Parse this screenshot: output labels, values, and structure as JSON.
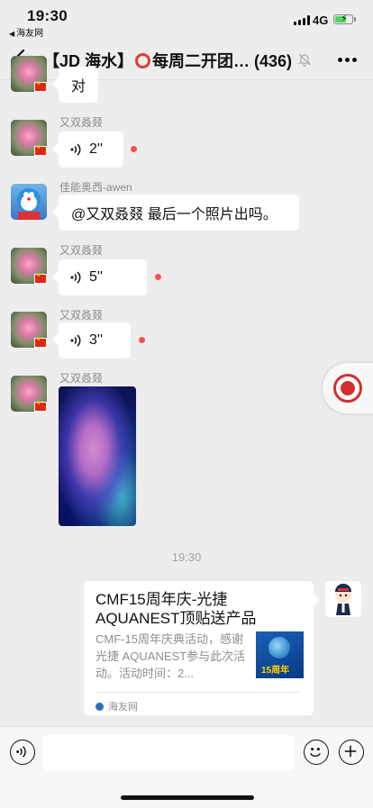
{
  "status_bar": {
    "time": "19:30",
    "back_app": "海友网",
    "network": "4G"
  },
  "nav": {
    "title_prefix": "【JD 海水】",
    "title_suffix": "每周二开团…",
    "member_count": "(436)"
  },
  "messages": [
    {
      "text": "对"
    },
    {
      "sender": "又双叒叕",
      "type": "voice",
      "duration": "2''",
      "unread": true
    },
    {
      "sender": "佳能奥西-awen",
      "type": "text",
      "text": "@又双叒叕 最后一个照片出吗。"
    },
    {
      "sender": "又双叒叕",
      "type": "voice",
      "duration": "5''",
      "unread": true
    },
    {
      "sender": "又双叒叕",
      "type": "voice",
      "duration": "3''",
      "unread": true
    },
    {
      "sender": "又双叒叕",
      "type": "image"
    }
  ],
  "timestamp": "19:30",
  "link_card": {
    "title": "CMF15周年庆-光捷AQUANEST顶贴送产品",
    "description": "CMF-15周年庆典活动，感谢光捷 AQUANEST参与此次活动。活动时间：2...",
    "thumb_text": "15周年",
    "source": "海友网"
  },
  "colors": {
    "unread_dot": "#fa5151",
    "background": "#ededed",
    "title_ring": "#e53935"
  },
  "icons": {
    "back": "chevron-left-icon",
    "mute": "bell-off-icon",
    "more": "more-dots-icon",
    "voice": "voice-wave-icon",
    "emoji": "emoji-icon",
    "plus": "plus-icon"
  }
}
